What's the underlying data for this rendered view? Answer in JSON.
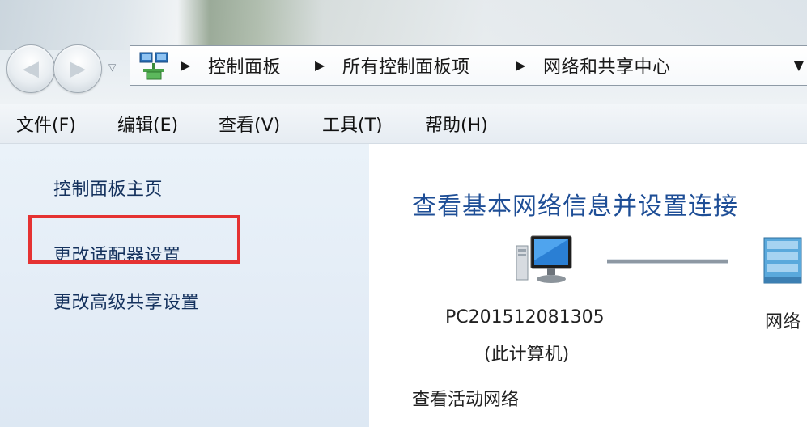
{
  "navigation": {
    "back_icon": "back-arrow-icon",
    "forward_icon": "forward-arrow-icon",
    "recent_pages_icon": "chevron-down-icon"
  },
  "address_bar": {
    "icon": "control-panel-network-icon",
    "breadcrumbs": [
      "控制面板",
      "所有控制面板项",
      "网络和共享中心"
    ],
    "dropdown_icon": "chevron-down-icon"
  },
  "menu": {
    "items": [
      "文件(F)",
      "编辑(E)",
      "查看(V)",
      "工具(T)",
      "帮助(H)"
    ]
  },
  "left_pane": {
    "links": [
      "控制面板主页",
      "更改适配器设置",
      "更改高级共享设置"
    ],
    "highlighted": "更改适配器设置",
    "highlight_color": "#e53232"
  },
  "main": {
    "heading": "查看基本网络信息并设置连接",
    "computer": {
      "name": "PC201512081305",
      "subtitle": "(此计算机)",
      "icon": "computer-monitor-icon"
    },
    "network": {
      "label": "网络",
      "icon": "network-server-icon"
    },
    "active_networks_label": "查看活动网络",
    "heading_color": "#1e4e96"
  }
}
